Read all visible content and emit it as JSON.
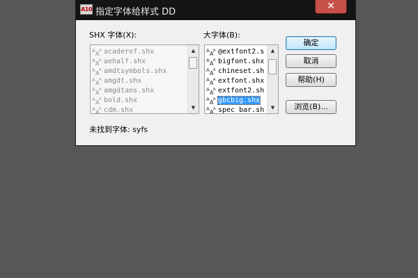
{
  "window": {
    "app_icon_text": "A10",
    "title": "指定字体给样式 DD",
    "close_symbol": "✕"
  },
  "shx_font": {
    "label": "SHX 字体(X):",
    "items": [
      "acaderef.shx",
      "aehalf.shx",
      "amdtsymbols.shx",
      "amgdt.shx",
      "amgdtans.shx",
      "bold.shx",
      "cdm.shx"
    ]
  },
  "big_font": {
    "label": "大字体(B):",
    "items": [
      "@extfont2.s",
      "bigfont.shx",
      "chineset.sh",
      "extfont.shx",
      "extfont2.sh",
      "gbcbig.shx",
      "spec_bar.sh"
    ],
    "selected_index": 5
  },
  "buttons": {
    "ok": "确定",
    "cancel": "取消",
    "help": "帮助(H)",
    "browse": "浏览(B)..."
  },
  "status": {
    "text": "未找到字体: syfs"
  },
  "icons": {
    "font_file": "shx-font-icon"
  }
}
